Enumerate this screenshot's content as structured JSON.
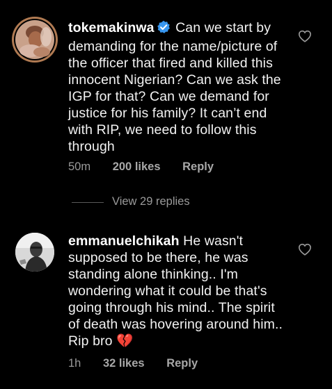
{
  "comments": [
    {
      "username": "tokemakinwa",
      "verified": true,
      "text": "Can we start by demanding for the name/picture of the officer that fired and killed this innocent Nigerian? Can we ask the IGP for that? Can we demand for justice for his family? It can’t end with RIP, we need to follow this through",
      "time": "50m",
      "likes": "200 likes",
      "reply_label": "Reply",
      "view_replies": "View 29 replies"
    },
    {
      "username": "emmanuelchikah",
      "verified": false,
      "text": "He wasn't supposed to be there, he was standing alone thinking.. I'm wondering what it could be that's going through his mind.. The spirit of death was hovering around him.. Rip bro 💔",
      "time": "1h",
      "likes": "32 likes",
      "reply_label": "Reply"
    }
  ],
  "icons": {
    "verified": "verified-badge-icon",
    "like": "heart-outline-icon",
    "broken_heart": "broken-heart-emoji"
  },
  "colors": {
    "background": "#000000",
    "text": "#f2f2f2",
    "secondary": "#9a9a9a",
    "verified": "#3897f0"
  }
}
